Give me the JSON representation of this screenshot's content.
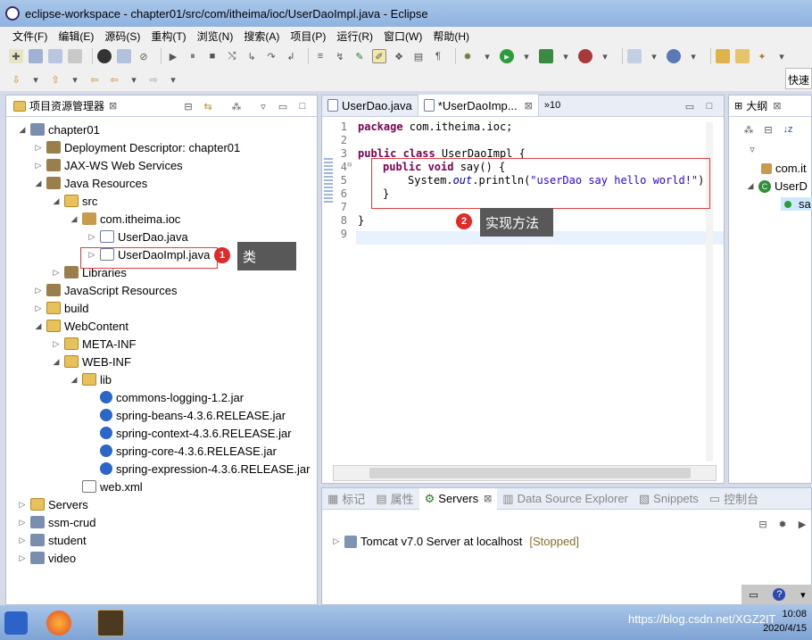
{
  "window": {
    "title": "eclipse-workspace - chapter01/src/com/itheima/ioc/UserDaoImpl.java - Eclipse"
  },
  "menu": [
    "文件(F)",
    "编辑(E)",
    "源码(S)",
    "重构(T)",
    "浏览(N)",
    "搜索(A)",
    "项目(P)",
    "运行(R)",
    "窗口(W)",
    "帮助(H)"
  ],
  "toolbar": {
    "quick_access": "快速"
  },
  "explorer": {
    "title": "项目资源管理器",
    "title_suffix": "⊠",
    "tree": [
      {
        "label": "chapter01",
        "icon": "project-icon",
        "toggle": "◢"
      },
      {
        "label": "Deployment Descriptor: chapter01",
        "icon": "descriptor-icon",
        "toggle": "▷"
      },
      {
        "label": "JAX-WS Web Services",
        "icon": "webservice-icon",
        "toggle": "▷"
      },
      {
        "label": "Java Resources",
        "icon": "java-resources-icon",
        "toggle": "◢"
      },
      {
        "label": "src",
        "icon": "folder-icon",
        "toggle": "◢"
      },
      {
        "label": "com.itheima.ioc",
        "icon": "package-icon",
        "toggle": "◢"
      },
      {
        "label": "UserDao.java",
        "icon": "java-file-icon",
        "toggle": "▷"
      },
      {
        "label": "UserDaoImpl.java",
        "icon": "java-file-icon",
        "toggle": "▷"
      },
      {
        "label": "Libraries",
        "icon": "library-icon",
        "toggle": "▷"
      },
      {
        "label": "JavaScript Resources",
        "icon": "js-resources-icon",
        "toggle": "▷"
      },
      {
        "label": "build",
        "icon": "folder-icon",
        "toggle": "▷"
      },
      {
        "label": "WebContent",
        "icon": "folder-icon",
        "toggle": "◢"
      },
      {
        "label": "META-INF",
        "icon": "folder-icon",
        "toggle": "▷"
      },
      {
        "label": "WEB-INF",
        "icon": "folder-icon",
        "toggle": "◢"
      },
      {
        "label": "lib",
        "icon": "folder-icon",
        "toggle": "◢"
      },
      {
        "label": "commons-logging-1.2.jar",
        "icon": "jar-icon",
        "toggle": ""
      },
      {
        "label": "spring-beans-4.3.6.RELEASE.jar",
        "icon": "jar-icon",
        "toggle": ""
      },
      {
        "label": "spring-context-4.3.6.RELEASE.jar",
        "icon": "jar-icon",
        "toggle": ""
      },
      {
        "label": "spring-core-4.3.6.RELEASE.jar",
        "icon": "jar-icon",
        "toggle": ""
      },
      {
        "label": "spring-expression-4.3.6.RELEASE.jar",
        "icon": "jar-icon",
        "toggle": ""
      },
      {
        "label": "web.xml",
        "icon": "xml-file-icon",
        "toggle": ""
      },
      {
        "label": "Servers",
        "icon": "folder-icon",
        "toggle": "▷"
      },
      {
        "label": "ssm-crud",
        "icon": "project-icon",
        "toggle": "▷"
      },
      {
        "label": "student",
        "icon": "project-icon",
        "toggle": "▷"
      },
      {
        "label": "video",
        "icon": "project-icon",
        "toggle": "▷"
      }
    ]
  },
  "editor": {
    "tabs": [
      {
        "label": "UserDao.java"
      },
      {
        "label": "*UserDaoImp..."
      },
      {
        "label": "»10"
      }
    ],
    "lines": [
      "1",
      "2",
      "3",
      "4",
      "5",
      "6",
      "7",
      "8",
      "9"
    ],
    "code": {
      "l1_kw": "package",
      "l1_rest": " com.itheima.ioc;",
      "l3_kw": "public class",
      "l3_rest": " UserDaoImpl {",
      "l4_kw": "public void",
      "l4_rest": " say() {",
      "l5_a": "System.",
      "l5_b": "out",
      "l5_c": ".println(",
      "l5_str": "\"userDao say hello world!\"",
      "l5_d": ");",
      "l6": "}",
      "l8": "}"
    }
  },
  "annotations": {
    "badge1": "1",
    "tip1": "类",
    "badge2": "2",
    "tip2": "实现方法"
  },
  "outline": {
    "title": "大纲",
    "items": [
      "com.it",
      "UserD",
      "sa"
    ]
  },
  "bottom": {
    "tabs": [
      "标记",
      "属性",
      "Servers",
      "Data Source Explorer",
      "Snippets",
      "控制台"
    ],
    "server_name": "Tomcat v7.0 Server at localhost",
    "server_status": "[Stopped]"
  },
  "taskbar": {
    "time": "10:08",
    "date": "2020/4/15",
    "watermark": "https://blog.csdn.net/XGZ2IT"
  }
}
